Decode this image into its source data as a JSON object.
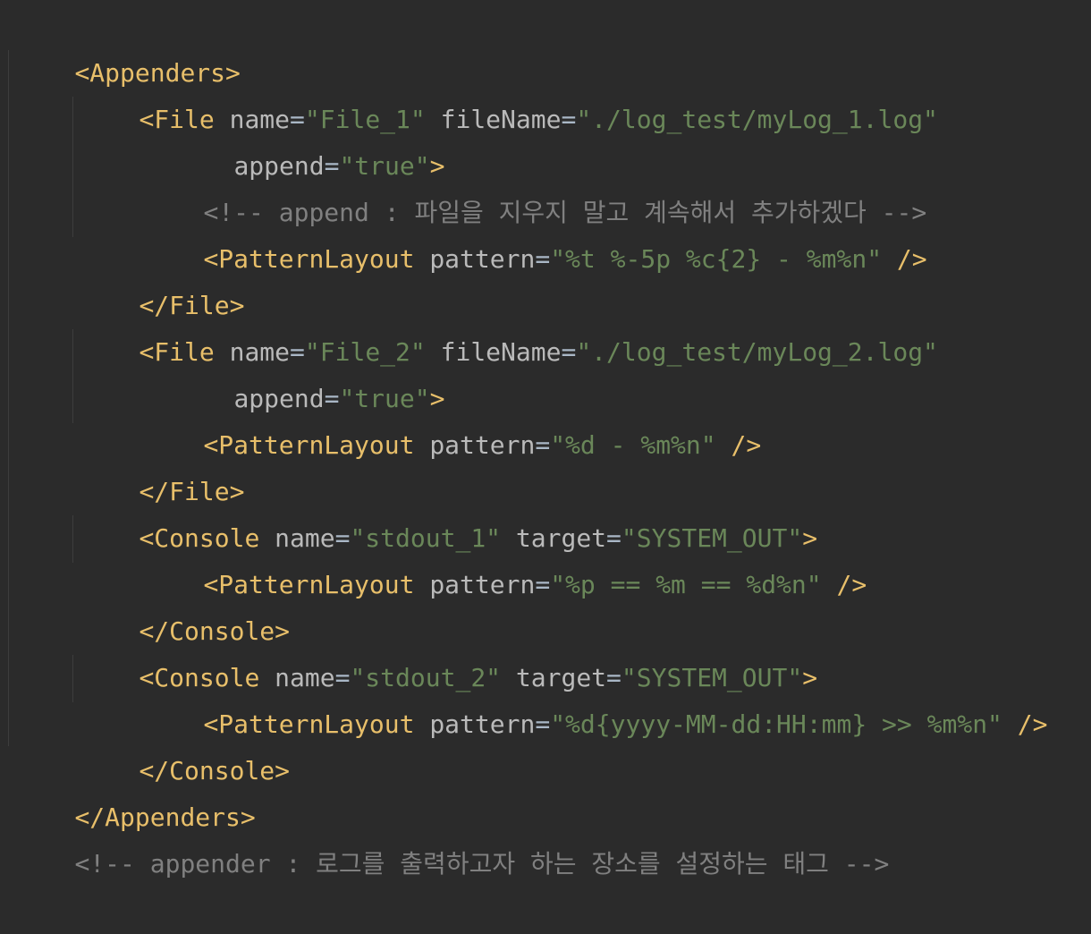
{
  "code": {
    "appenders_open": "<Appenders>",
    "appenders_close": "</Appenders>",
    "file_open": "<File",
    "file_close": "</File>",
    "console_open": "<Console",
    "console_close": "</Console>",
    "pattern_open": "<PatternLayout",
    "self_close": "/>",
    "gt": ">",
    "eq": "=",
    "attr_name": "name",
    "attr_file_name": "fileName",
    "attr_append": "append",
    "attr_pattern": "pattern",
    "attr_target": "target",
    "file1_name": "\"File_1\"",
    "file1_path": "\"./log_test/myLog_1.log\"",
    "append_value": "\"true\"",
    "comment_append": "<!-- append : 파일을 지우지 말고 계속해서 추가하겠다 -->",
    "file1_pattern": "\"%t %-5p %c{2} - %m%n\"",
    "file2_name": "\"File_2\"",
    "file2_path": "\"./log_test/myLog_2.log\"",
    "file2_pattern": "\"%d - %m%n\"",
    "console1_name": "\"stdout_1\"",
    "target_value": "\"SYSTEM_OUT\"",
    "console1_pattern": "\"%p == %m == %d%n\"",
    "console2_name": "\"stdout_2\"",
    "console2_pattern": "\"%d{yyyy-MM-dd:HH:mm} >> %m%n\"",
    "comment_appender": "<!-- appender : 로그를 출력하고자 하는 장소를 설정하는 태그 -->"
  }
}
